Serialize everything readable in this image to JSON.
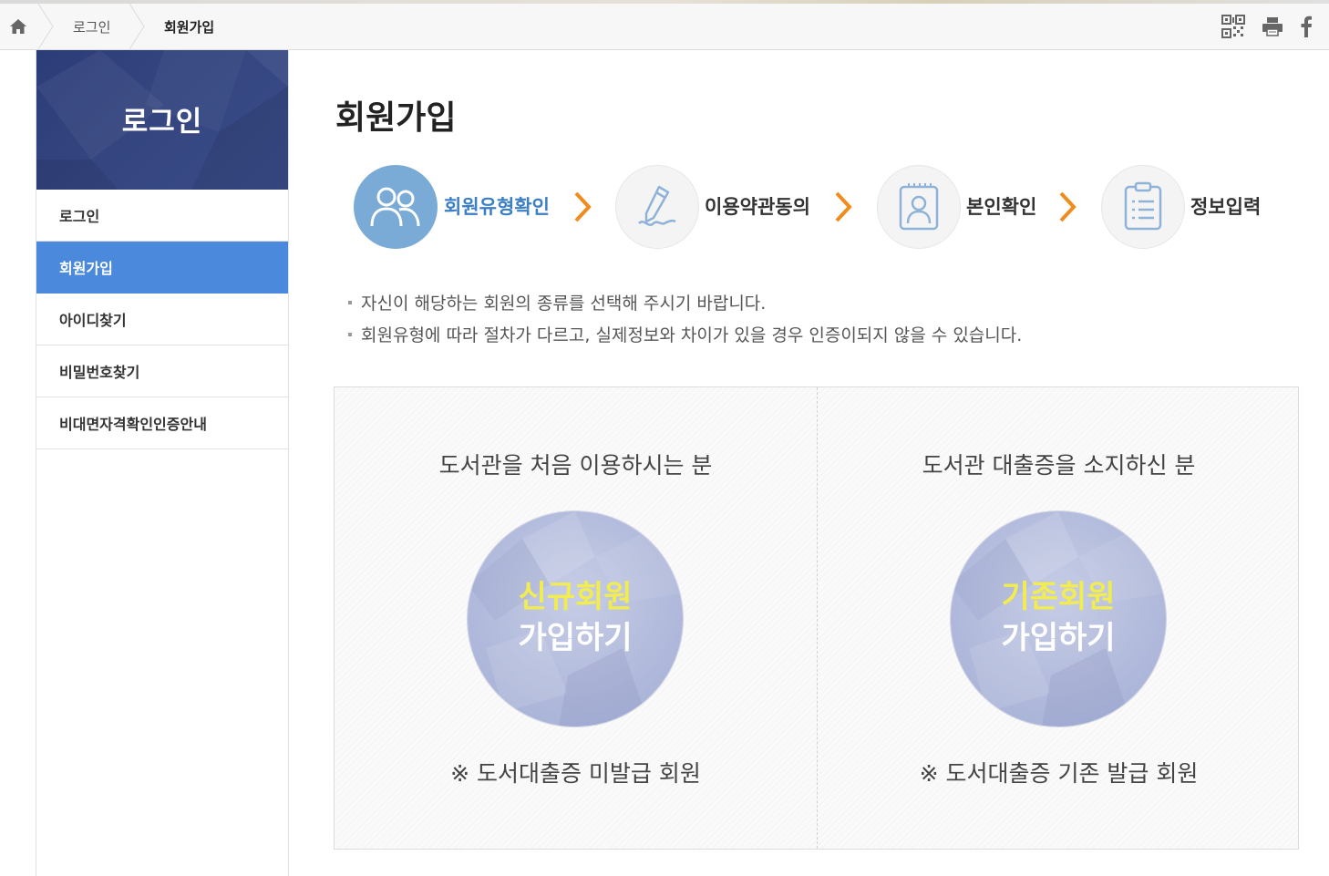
{
  "breadcrumb": {
    "home_icon": "home-icon",
    "items": [
      "로그인",
      "회원가입"
    ]
  },
  "top_icons": [
    "qr-code-icon",
    "print-icon",
    "facebook-icon"
  ],
  "sidebar": {
    "title": "로그인",
    "items": [
      {
        "label": "로그인",
        "active": false
      },
      {
        "label": "회원가입",
        "active": true
      },
      {
        "label": "아이디찾기",
        "active": false
      },
      {
        "label": "비밀번호찾기",
        "active": false
      },
      {
        "label": "비대면자격확인인증안내",
        "active": false
      }
    ]
  },
  "page": {
    "title": "회원가입"
  },
  "steps": [
    {
      "label": "회원유형확인",
      "icon": "users-icon",
      "active": true
    },
    {
      "label": "이용약관동의",
      "icon": "pen-signature-icon",
      "active": false
    },
    {
      "label": "본인확인",
      "icon": "id-badge-icon",
      "active": false
    },
    {
      "label": "정보입력",
      "icon": "clipboard-list-icon",
      "active": false
    }
  ],
  "notes": [
    "자신이 해당하는 회원의 종류를 선택해 주시기 바랍니다.",
    "회원유형에 따라 절차가 다르고, 실제정보와 차이가 있을 경우 인증이되지 않을 수 있습니다."
  ],
  "choices": {
    "new": {
      "heading": "도서관을 처음 이용하시는 분",
      "button_line1": "신규회원",
      "button_line2": "가입하기",
      "footnote": "※ 도서대출증 미발급 회원"
    },
    "existing": {
      "heading": "도서관 대출증을 소지하신 분",
      "button_line1": "기존회원",
      "button_line2": "가입하기",
      "footnote": "※ 도서대출증 기존 발급 회원"
    }
  },
  "colors": {
    "sidebar_header": "#34457f",
    "active_item": "#4a89dc",
    "step_active": "#7aaad6",
    "step_arrow": "#f08c1e",
    "button_highlight": "#f1ec4f"
  }
}
